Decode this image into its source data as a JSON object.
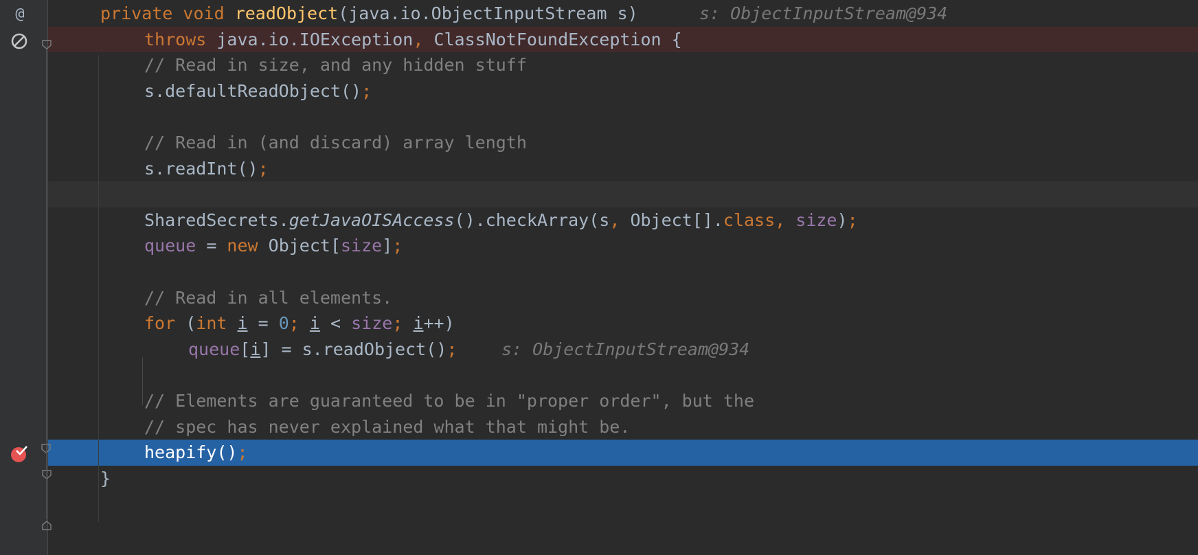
{
  "gutter_marks": {
    "override": "@",
    "exception_breakpoint": "no-entry-icon",
    "breakpoint": "breakpoint-check-icon"
  },
  "lines": {
    "l1": {
      "kw1": "private ",
      "kw2": "void ",
      "name": "readObject",
      "params": "(java.io.ObjectInputStream s)",
      "hint": "s: ObjectInputStream@934"
    },
    "l2": {
      "kw": "throws ",
      "t1": "java.io.IOException",
      "comma": ", ",
      "t2": "ClassNotFoundException {"
    },
    "l3": {
      "comment": "// Read in size, and any hidden stuff"
    },
    "l4": {
      "call": "s.defaultReadObject()",
      "semi": ";"
    },
    "l6": {
      "comment": "// Read in (and discard) array length"
    },
    "l7": {
      "call": "s.readInt()",
      "semi": ";"
    },
    "l9": {
      "a": "SharedSecrets.",
      "b": "getJavaOISAccess",
      "c": "().checkArray(s",
      "d": ", ",
      "e": "Object[].",
      "f": "class",
      "g": ", ",
      "h": "size",
      "i": ")",
      "j": ";"
    },
    "l10": {
      "a": "queue",
      "b": " = ",
      "c": "new ",
      "d": "Object[",
      "e": "size",
      "f": "]",
      "g": ";"
    },
    "l12": {
      "comment": "// Read in all elements."
    },
    "l13": {
      "a": "for ",
      "b": "(",
      "c": "int ",
      "d": "i",
      "e": " = ",
      "f": "0",
      "g": "; ",
      "h": "i",
      "i": " < ",
      "j": "size",
      "k": "; ",
      "l": "i",
      "m": "++)"
    },
    "l14": {
      "a": "queue",
      "b": "[",
      "c": "i",
      "d": "] = s.readObject()",
      "e": ";",
      "hint": "s: ObjectInputStream@934"
    },
    "l16": {
      "comment": "// Elements are guaranteed to be in \"proper order\", but the"
    },
    "l17": {
      "comment": "// spec has never explained what that might be."
    },
    "l18": {
      "call": "heapify()",
      "semi": ";"
    },
    "l19": {
      "brace": "}"
    }
  }
}
